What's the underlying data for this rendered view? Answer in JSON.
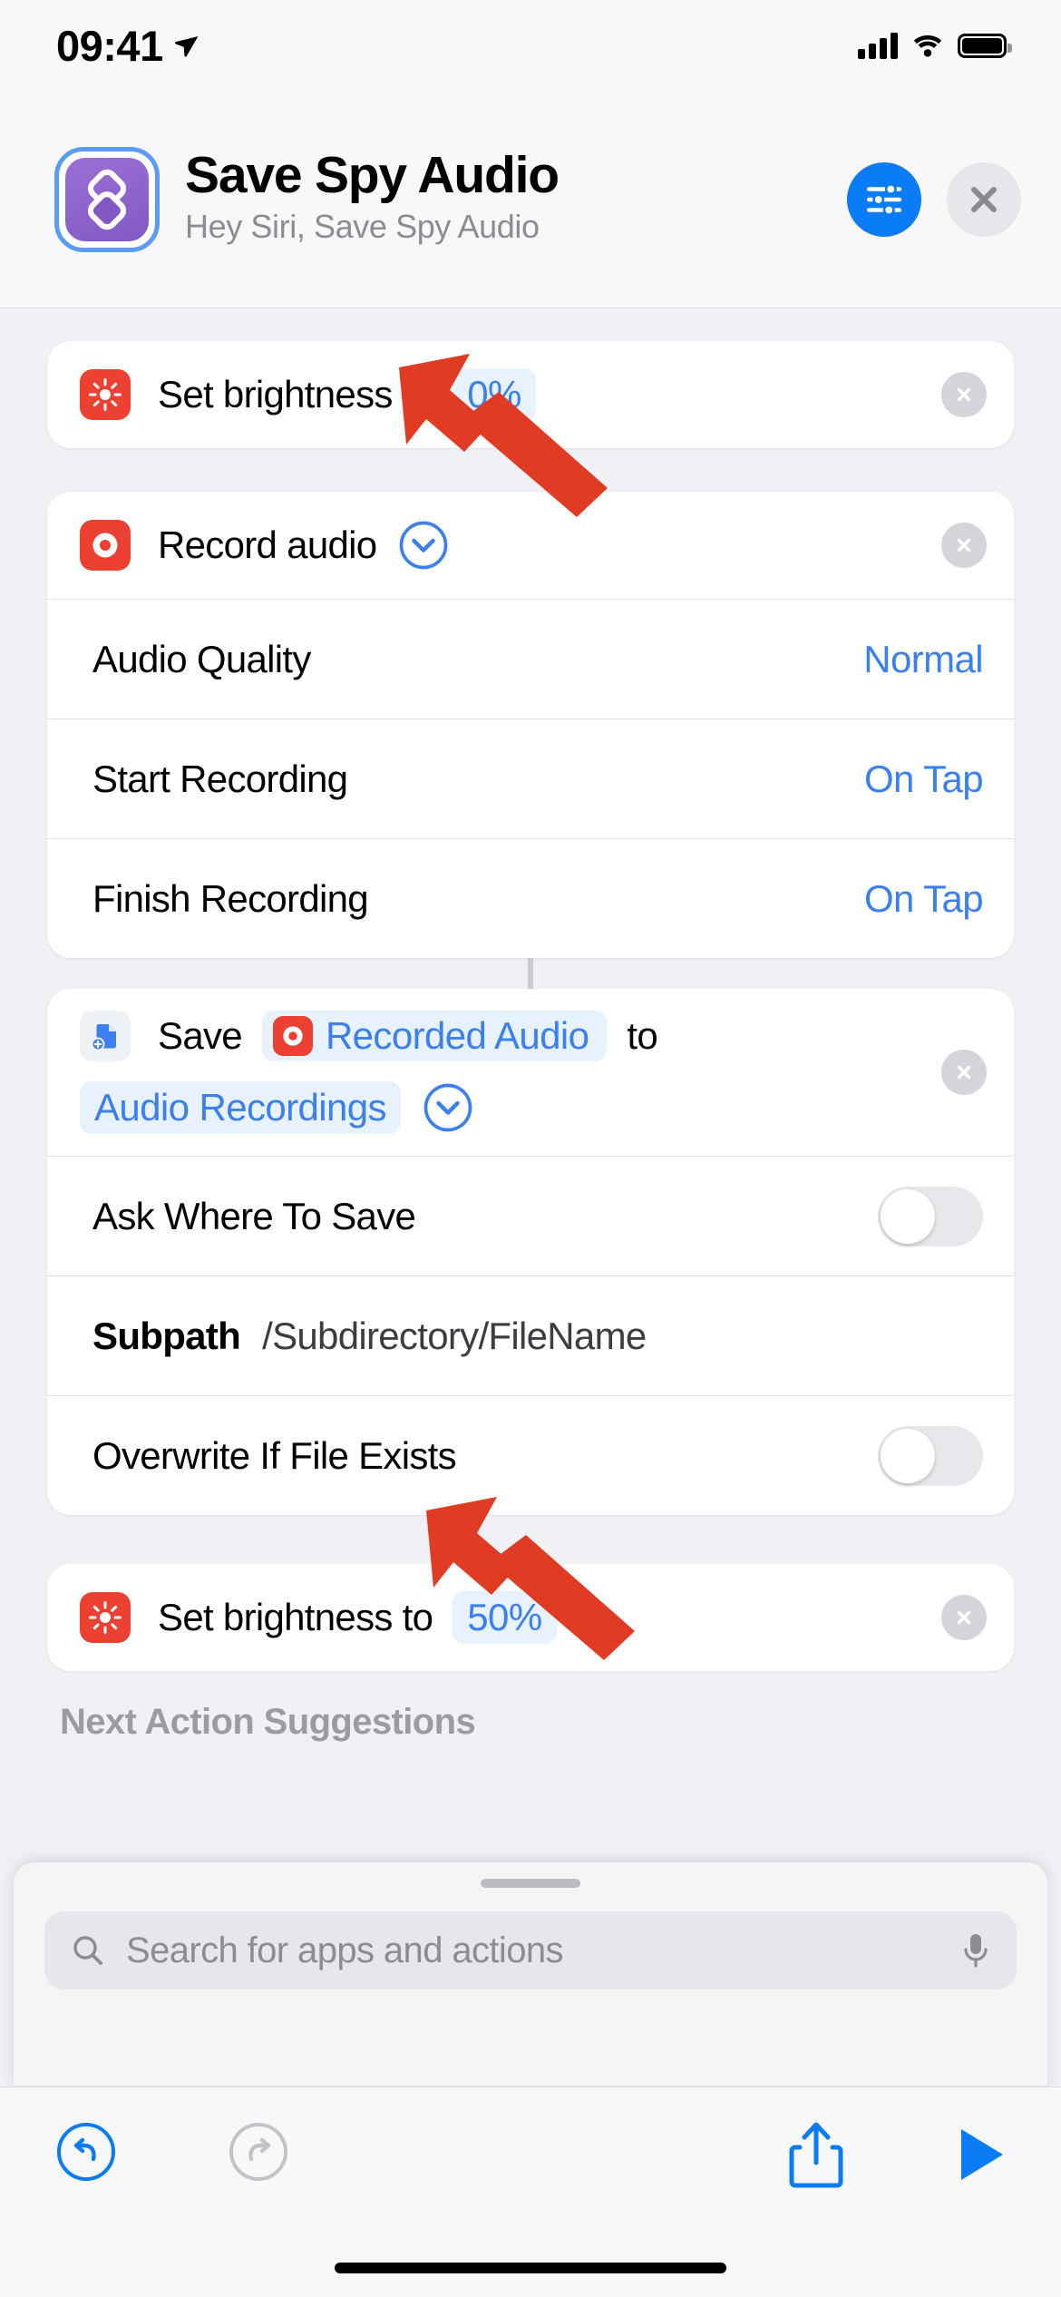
{
  "status_bar": {
    "time": "09:41",
    "location_icon": "location-arrow-icon",
    "cellular_icon": "cellular-bars-icon",
    "wifi_icon": "wifi-icon",
    "battery_icon": "battery-full-icon"
  },
  "header": {
    "app_icon": "shortcuts-app-icon",
    "title": "Save Spy Audio",
    "subtitle": "Hey Siri, Save Spy Audio",
    "settings_button": "sliders-icon",
    "close_button": "close-icon",
    "icon_gradient_start": "#9b6fd4",
    "icon_gradient_end": "#8259c4",
    "selection_ring_color": "#5a9cf8",
    "settings_button_color": "#0a7cf6"
  },
  "colors": {
    "accent_blue": "#3b7ff0",
    "pill_background": "#e8f1fe",
    "action_icon_red": "#ec4132",
    "page_background": "#f1f1f5",
    "card_background": "#ffffff",
    "toggle_off": "#e7e7ec",
    "annotation_arrow": "#e03c24"
  },
  "actions": [
    {
      "id": "set-brightness-0",
      "icon": "brightness-sun-icon",
      "label": "Set brightness to",
      "value_pill": "0%",
      "remove_button": "remove-action-icon"
    },
    {
      "id": "record-audio",
      "icon": "record-audio-icon",
      "label": "Record audio",
      "expand_button": "chevron-down-circle-icon",
      "remove_button": "remove-action-icon",
      "parameters": [
        {
          "label": "Audio Quality",
          "value": "Normal",
          "type": "value"
        },
        {
          "label": "Start Recording",
          "value": "On Tap",
          "type": "value"
        },
        {
          "label": "Finish Recording",
          "value": "On Tap",
          "type": "value"
        }
      ]
    },
    {
      "id": "save-file",
      "icon": "save-file-icon",
      "label": "Save",
      "variable_token": "Recorded Audio",
      "variable_token_icon": "record-audio-icon",
      "connector_word": "to",
      "destination_pill": "Audio Recordings",
      "expand_button": "chevron-down-circle-icon",
      "remove_button": "remove-action-icon",
      "parameters": [
        {
          "label": "Ask Where To Save",
          "value": "",
          "type": "toggle",
          "on": false
        },
        {
          "label": "Subpath",
          "value": "/Subdirectory/FileName",
          "type": "text"
        },
        {
          "label": "Overwrite If File Exists",
          "value": "",
          "type": "toggle",
          "on": false
        }
      ]
    },
    {
      "id": "set-brightness-50",
      "icon": "brightness-sun-icon",
      "label": "Set brightness to",
      "value_pill": "50%",
      "remove_button": "remove-action-icon"
    }
  ],
  "next_action_suggestions": "Next Action Suggestions",
  "sheet": {
    "grabber": "sheet-grabber",
    "search": {
      "icon": "search-icon",
      "placeholder": "Search for apps and actions",
      "value": "",
      "mic_icon": "microphone-icon"
    }
  },
  "toolbar": {
    "undo": "undo-icon",
    "redo": "redo-icon",
    "share": "share-icon",
    "play": "play-icon",
    "undo_enabled": true,
    "redo_enabled": false
  },
  "annotations": [
    {
      "name": "arrow-to-brightness-0",
      "points_to": "0%",
      "color": "#e03c24"
    },
    {
      "name": "arrow-to-brightness-50",
      "points_to": "50%",
      "color": "#e03c24"
    }
  ]
}
